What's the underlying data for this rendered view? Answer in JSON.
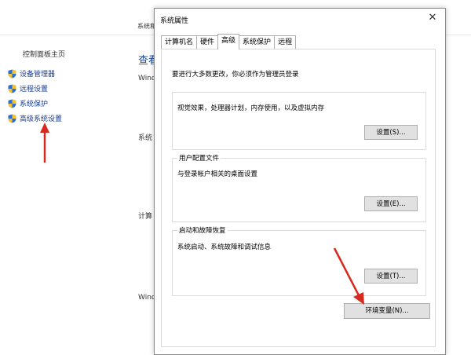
{
  "background": {
    "path_fragment": "系统和",
    "home_link": "控制面板主页",
    "side_links": [
      "设备管理器",
      "远程设置",
      "系统保护",
      "高级系统设置"
    ],
    "view_heading": "查看",
    "fragments": {
      "win": "Wind",
      "sys": "系统",
      "comp": "计算",
      "win2": "Wind"
    }
  },
  "dialog": {
    "title": "系统属性",
    "close_glyph": "✕",
    "tabs": [
      "计算机名",
      "硬件",
      "高级",
      "系统保护",
      "远程"
    ],
    "active_tab": "高级",
    "admin_note": "要进行大多数更改，你必须作为管理员登录",
    "performance": {
      "title": "",
      "description": "视觉效果，处理器计划，内存使用，以及虚拟内存",
      "button": "设置(S)..."
    },
    "user_profiles": {
      "title": "用户配置文件",
      "description": "与登录帐户相关的桌面设置",
      "button": "设置(E)..."
    },
    "startup": {
      "title": "启动和故障恢复",
      "description": "系统启动、系统故障和调试信息",
      "button": "设置(T)..."
    },
    "env_button": "环境变量(N)..."
  }
}
